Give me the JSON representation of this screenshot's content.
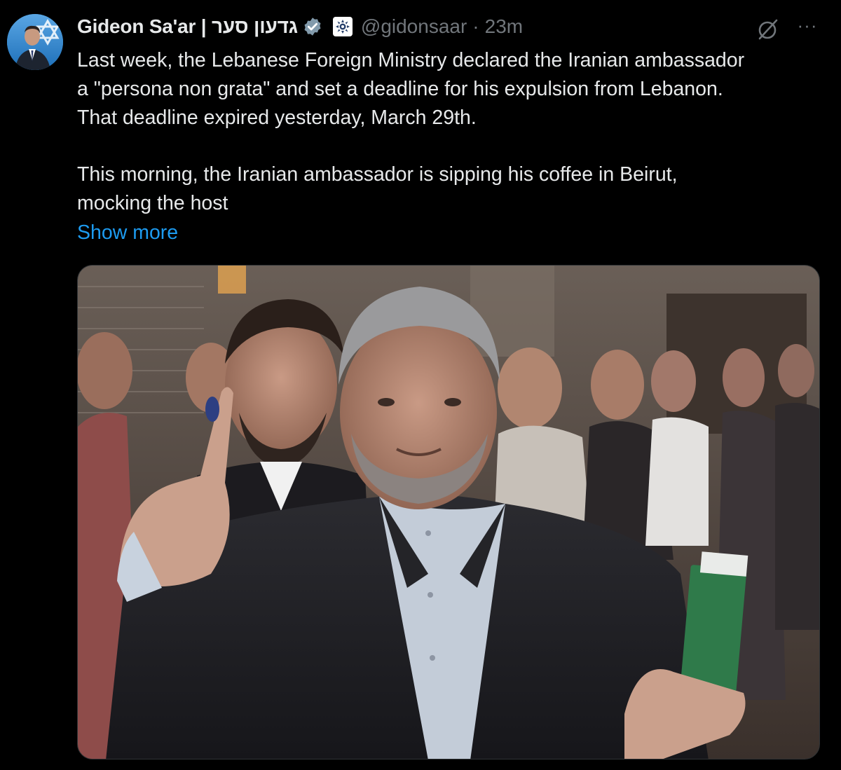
{
  "author": {
    "display_name": "Gideon Sa'ar | גדעון סער",
    "handle": "@gidonsaar",
    "separator": "·",
    "time": "23m",
    "verified_icon": "verified-badge-icon",
    "affiliate_icon": "government-affiliate-icon",
    "avatar_icon": "profile-avatar"
  },
  "actions": {
    "grok_icon": "grok-slash-icon",
    "more_label": "···"
  },
  "post": {
    "lines": [
      "Last week, the Lebanese Foreign Ministry declared the Iranian ambassador",
      "a \"persona non grata\" and set a deadline for his expulsion from Lebanon.",
      "That deadline expired yesterday, March 29th.",
      "",
      "This morning, the Iranian ambassador is sipping his coffee in Beirut,",
      "mocking the host"
    ],
    "show_more": "Show more"
  },
  "media": {
    "kind": "photo",
    "description_icon": "post-photo"
  },
  "colors": {
    "background": "#000000",
    "text": "#e7e9ea",
    "secondary": "#71767b",
    "link": "#1d9bf0",
    "verified": "#829aab"
  }
}
